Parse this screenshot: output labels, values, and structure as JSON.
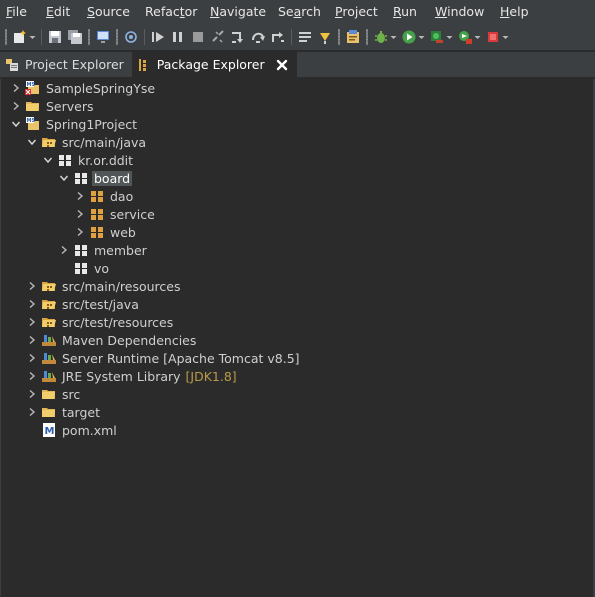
{
  "menu": [
    {
      "mnemonic": "F",
      "rest": "ile"
    },
    {
      "mnemonic": "E",
      "rest": "dit"
    },
    {
      "mnemonic": "S",
      "rest": "ource"
    },
    {
      "pre": "Refac",
      "mnemonic": "t",
      "rest": "or"
    },
    {
      "mnemonic": "N",
      "rest": "avigate"
    },
    {
      "pre": "Se",
      "mnemonic": "a",
      "rest": "rch"
    },
    {
      "mnemonic": "P",
      "rest": "roject"
    },
    {
      "mnemonic": "R",
      "rest": "un"
    },
    {
      "mnemonic": "W",
      "rest": "indow"
    },
    {
      "mnemonic": "H",
      "rest": "elp"
    }
  ],
  "toolbar_icons": [
    "new-icon",
    "save-icon",
    "save-all-icon",
    "console-icon",
    "skip-breakpoints-icon",
    "resume-icon",
    "suspend-icon",
    "terminate-icon",
    "disconnect-icon",
    "step-into-icon",
    "step-over-icon",
    "step-return-icon",
    "toggle-word-wrap-icon",
    "next-annotation-icon",
    "open-task-icon",
    "debug-icon",
    "run-icon",
    "run-last-icon",
    "coverage-icon",
    "stop-server-icon"
  ],
  "tabs": [
    {
      "label": "Project Explorer",
      "icon": "project-explorer-icon",
      "active": false
    },
    {
      "label": "Package Explorer",
      "icon": "package-explorer-icon",
      "active": true
    }
  ],
  "tree": [
    {
      "label": "SampleSpringYse",
      "icon": "project-error-icon",
      "depth": 0,
      "twisty": "collapsed"
    },
    {
      "label": "Servers",
      "icon": "folder-icon",
      "depth": 0,
      "twisty": "collapsed"
    },
    {
      "label": "Spring1Project",
      "icon": "project-icon",
      "depth": 0,
      "twisty": "expanded"
    },
    {
      "label": "src/main/java",
      "icon": "source-folder-icon",
      "depth": 1,
      "twisty": "expanded"
    },
    {
      "label": "kr.or.ddit",
      "icon": "package-icon",
      "depth": 2,
      "twisty": "expanded"
    },
    {
      "label": "board",
      "icon": "package-icon",
      "depth": 3,
      "twisty": "expanded",
      "selected": true
    },
    {
      "label": "dao",
      "icon": "package-orange-icon",
      "depth": 4,
      "twisty": "collapsed"
    },
    {
      "label": "service",
      "icon": "package-orange-icon",
      "depth": 4,
      "twisty": "collapsed"
    },
    {
      "label": "web",
      "icon": "package-orange-icon",
      "depth": 4,
      "twisty": "collapsed"
    },
    {
      "label": "member",
      "icon": "package-icon",
      "depth": 3,
      "twisty": "collapsed"
    },
    {
      "label": "vo",
      "icon": "package-icon",
      "depth": 3,
      "twisty": "none"
    },
    {
      "label": "src/main/resources",
      "icon": "source-folder-icon",
      "depth": 1,
      "twisty": "collapsed"
    },
    {
      "label": "src/test/java",
      "icon": "source-folder-icon",
      "depth": 1,
      "twisty": "collapsed"
    },
    {
      "label": "src/test/resources",
      "icon": "source-folder-icon",
      "depth": 1,
      "twisty": "collapsed"
    },
    {
      "label": "Maven Dependencies",
      "icon": "library-icon",
      "depth": 1,
      "twisty": "collapsed"
    },
    {
      "label": "Server Runtime [Apache Tomcat v8.5]",
      "icon": "library-icon",
      "depth": 1,
      "twisty": "collapsed"
    },
    {
      "label": "JRE System Library",
      "decoration": "[JDK1.8]",
      "icon": "library-icon",
      "depth": 1,
      "twisty": "collapsed"
    },
    {
      "label": "src",
      "icon": "folder-icon",
      "depth": 1,
      "twisty": "collapsed"
    },
    {
      "label": "target",
      "icon": "folder-icon",
      "depth": 1,
      "twisty": "collapsed"
    },
    {
      "label": "pom.xml",
      "icon": "maven-file-icon",
      "depth": 1,
      "twisty": "none"
    }
  ],
  "colors": {
    "background": "#2b2b2b",
    "chrome": "#3c3f41",
    "selection": "#515658",
    "decoration": "#b99a4a",
    "close": "#ffffff"
  }
}
